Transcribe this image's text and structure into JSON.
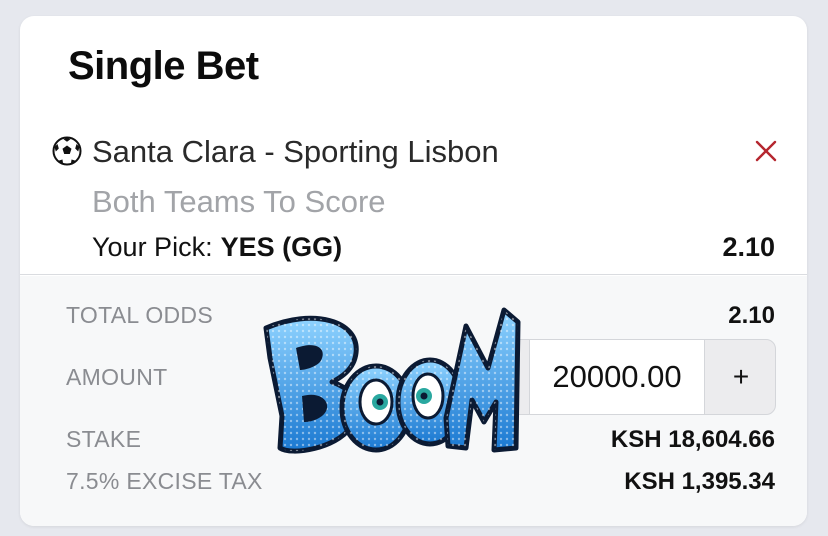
{
  "title": "Single Bet",
  "bet": {
    "sport_icon": "soccer-ball-icon",
    "match": "Santa Clara - Sporting Lisbon",
    "market": "Both Teams To Score",
    "pick_label": "Your Pick:",
    "pick_value": "YES (GG)",
    "odds": "2.10"
  },
  "summary": {
    "total_odds_label": "TOTAL ODDS",
    "total_odds": "2.10",
    "amount_label": "AMOUNT",
    "amount_value": "20000.00",
    "increment_label": "+",
    "stake_label": "STAKE",
    "stake": "KSH 18,604.66",
    "tax_label": "7.5% EXCISE TAX",
    "tax": "KSH 1,395.34"
  },
  "sticker_text": "BOOM",
  "colors": {
    "close": "#b5262f",
    "muted_text": "#a2a4a8",
    "background": "#e6e8ee",
    "sticker_blue": "#2d8fe0"
  }
}
